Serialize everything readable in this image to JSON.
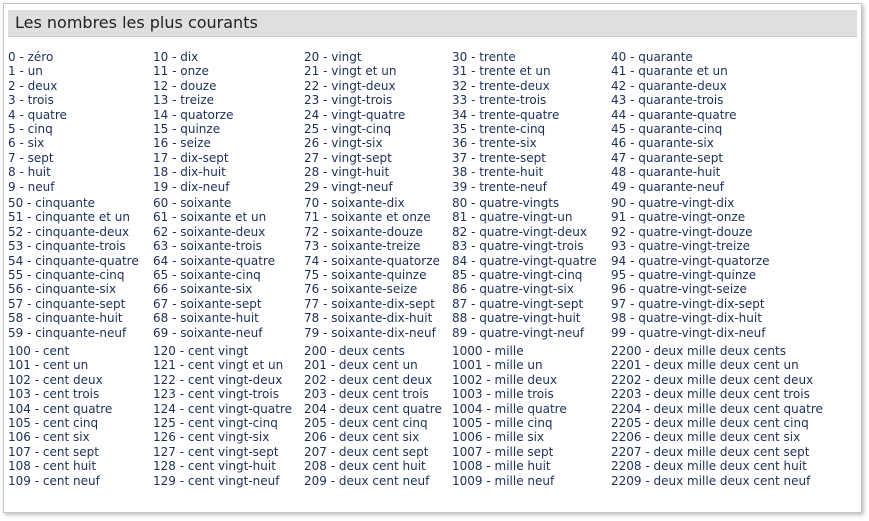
{
  "title": "Les nombres les plus courants",
  "blocks": [
    [
      [
        "0 - zéro",
        "1 - un",
        "2 - deux",
        "3 - trois",
        "4 - quatre",
        "5 - cinq",
        "6 - six",
        "7 - sept",
        "8 - huit",
        "9 - neuf"
      ],
      [
        "10 - dix",
        "11 - onze",
        "12 - douze",
        "13 - treize",
        "14 - quatorze",
        "15 - quinze",
        "16 - seize",
        "17 - dix-sept",
        "18 - dix-huit",
        "19 - dix-neuf"
      ],
      [
        "20 - vingt",
        "21 - vingt et un",
        "22 - vingt-deux",
        "23 - vingt-trois",
        "24 - vingt-quatre",
        "25 - vingt-cinq",
        "26 - vingt-six",
        "27 - vingt-sept",
        "28 - vingt-huit",
        "29 - vingt-neuf"
      ],
      [
        "30 - trente",
        "31 - trente et un",
        "32 - trente-deux",
        "33 - trente-trois",
        "34 - trente-quatre",
        "35 - trente-cinq",
        "36 - trente-six",
        "37 - trente-sept",
        "38 - trente-huit",
        "39 - trente-neuf"
      ],
      [
        "40 - quarante",
        "41 - quarante et un",
        "42 - quarante-deux",
        "43 - quarante-trois",
        "44 - quarante-quatre",
        "45 - quarante-cinq",
        "46 - quarante-six",
        "47 - quarante-sept",
        "48 - quarante-huit",
        "49 - quarante-neuf"
      ]
    ],
    [
      [
        "50 - cinquante",
        "51 - cinquante et un",
        "52 - cinquante-deux",
        "53 - cinquante-trois",
        "54 - cinquante-quatre",
        "55 - cinquante-cinq",
        "56 - cinquante-six",
        "57 - cinquante-sept",
        "58 - cinquante-huit",
        "59 - cinquante-neuf"
      ],
      [
        "60 - soixante",
        "61 - soixante et un",
        "62 - soixante-deux",
        "63 - soixante-trois",
        "64 - soixante-quatre",
        "65 - soixante-cinq",
        "66 - soixante-six",
        "67 - soixante-sept",
        "68 - soixante-huit",
        "69 - soixante-neuf"
      ],
      [
        "70 - soixante-dix",
        "71 - soixante et onze",
        "72 - soixante-douze",
        "73 - soixante-treize",
        "74 - soixante-quatorze",
        "75 - soixante-quinze",
        "76 - soixante-seize",
        "77 - soixante-dix-sept",
        "78 - soixante-dix-huit",
        "79 - soixante-dix-neuf"
      ],
      [
        "80 - quatre-vingts",
        "81 - quatre-vingt-un",
        "82 - quatre-vingt-deux",
        "83 - quatre-vingt-trois",
        "84 - quatre-vingt-quatre",
        "85 - quatre-vingt-cinq",
        "86 - quatre-vingt-six",
        "87 - quatre-vingt-sept",
        "88 - quatre-vingt-huit",
        "89 - quatre-vingt-neuf"
      ],
      [
        "90 - quatre-vingt-dix",
        "91 - quatre-vingt-onze",
        "92 - quatre-vingt-douze",
        "93 - quatre-vingt-treize",
        "94 - quatre-vingt-quatorze",
        "95 - quatre-vingt-quinze",
        "96 - quatre-vingt-seize",
        "97 - quatre-vingt-dix-sept",
        "98 - quatre-vingt-dix-huit",
        "99 - quatre-vingt-dix-neuf"
      ]
    ],
    [
      [
        "100 - cent",
        "101 - cent un",
        "102 - cent deux",
        "103 - cent trois",
        "104 - cent quatre",
        "105 - cent cinq",
        "106 - cent six",
        "107 - cent sept",
        "108 - cent huit",
        "109 - cent neuf"
      ],
      [
        "120 - cent vingt",
        "121 - cent vingt et un",
        "122 - cent vingt-deux",
        "123 - cent vingt-trois",
        "124 - cent vingt-quatre",
        "125 - cent vingt-cinq",
        "126 - cent vingt-six",
        "127 - cent vingt-sept",
        "128 - cent vingt-huit",
        "129 - cent vingt-neuf"
      ],
      [
        "200 - deux cents",
        "201 - deux cent un",
        "202 - deux cent deux",
        "203 - deux cent trois",
        "204 - deux cent quatre",
        "205 - deux cent cinq",
        "206 - deux cent six",
        "207 - deux cent sept",
        "208 - deux cent huit",
        "209 - deux cent neuf"
      ],
      [
        "1000 - mille",
        "1001 - mille un",
        "1002 - mille deux",
        "1003 - mille trois",
        "1004 - mille quatre",
        "1005 - mille cinq",
        "1006 - mille six",
        "1007 - mille sept",
        "1008 - mille huit",
        "1009 - mille neuf"
      ],
      [
        "2200 - deux mille deux cents",
        "2201 - deux mille deux cent un",
        "2202 - deux mille deux cent deux",
        "2203 - deux mille deux cent trois",
        "2204 - deux mille deux cent quatre",
        "2205 - deux mille deux cent cinq",
        "2206 - deux mille deux cent six",
        "2207 - deux mille deux cent sept",
        "2208 - deux mille deux cent huit",
        "2209 - deux mille deux cent neuf"
      ]
    ]
  ]
}
